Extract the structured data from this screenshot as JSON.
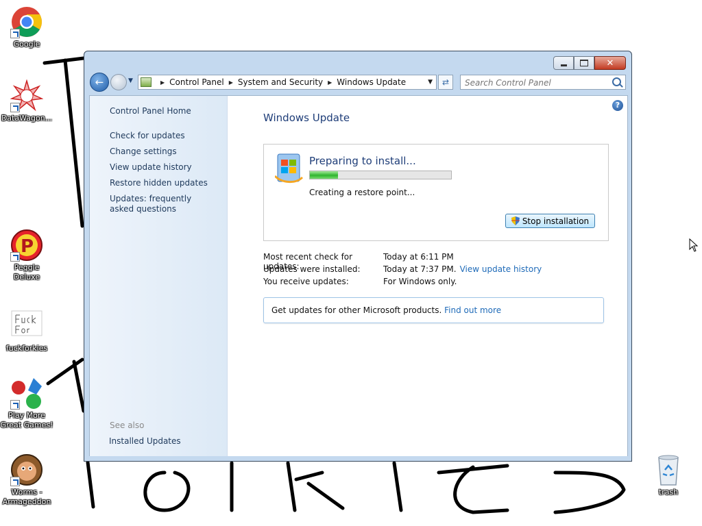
{
  "desktop": {
    "icons": [
      {
        "label": "Google",
        "icon": "chrome-icon"
      },
      {
        "label": "DataWagon...",
        "icon": "datawagon-icon"
      },
      {
        "label": "Peggle Deluxe",
        "icon": "peggle-icon"
      },
      {
        "label": "fuckforkies",
        "icon": "fuckforkies-icon",
        "logo_text": "Fuck Forkies"
      },
      {
        "label": "Play More Great Games!",
        "icon": "games-icon"
      },
      {
        "label": "Worms - Armageddon",
        "icon": "worms-icon"
      },
      {
        "label": "trash",
        "icon": "recycle-bin-icon"
      }
    ]
  },
  "window": {
    "address": {
      "crumbs": [
        "Control Panel",
        "System and Security",
        "Windows Update"
      ]
    },
    "search": {
      "placeholder": "Search Control Panel"
    },
    "sidebar": {
      "home": "Control Panel Home",
      "links": [
        "Check for updates",
        "Change settings",
        "View update history",
        "Restore hidden updates",
        "Updates: frequently asked questions"
      ],
      "see_also": "See also",
      "installed_updates": "Installed Updates"
    },
    "main": {
      "title": "Windows Update",
      "status": {
        "title": "Preparing to install...",
        "progress": 0.2,
        "sub": "Creating a restore point...",
        "stop_button": "Stop installation"
      },
      "info": {
        "recent_check_label": "Most recent check for updates:",
        "recent_check_value": "Today at 6:11 PM",
        "installed_label": "Updates were installed:",
        "installed_value": "Today at 7:37 PM.",
        "installed_link": "View update history",
        "receive_label": "You receive updates:",
        "receive_value": "For Windows only."
      },
      "other_products": {
        "text": "Get updates for other Microsoft products.",
        "link": "Find out more"
      }
    }
  }
}
